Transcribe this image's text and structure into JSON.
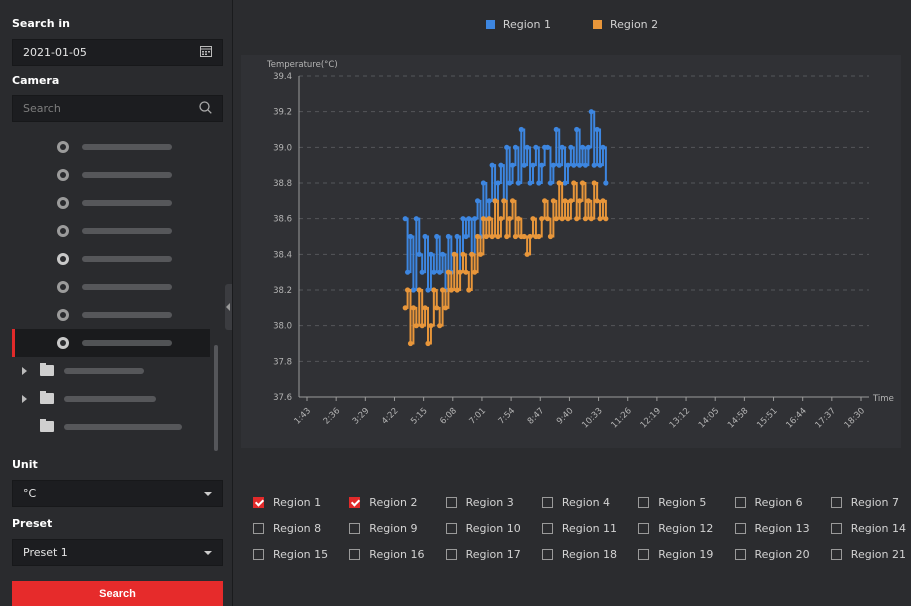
{
  "left": {
    "search_in_label": "Search in",
    "date_value": "2021-01-05",
    "camera_label": "Camera",
    "search_placeholder": "Search",
    "unit_label": "Unit",
    "unit_value": "°C",
    "preset_label": "Preset",
    "preset_value": "Preset 1",
    "search_button": "Search"
  },
  "legend": [
    {
      "name": "Region 1",
      "color": "#3d86e0"
    },
    {
      "name": "Region 2",
      "color": "#e8963a"
    }
  ],
  "chart_data": {
    "type": "line",
    "ylabel": "Temperature(°C)",
    "xlabel": "Time",
    "ylim": [
      37.6,
      39.4
    ],
    "yticks": [
      "37.6",
      "37.8",
      "38.0",
      "38.2",
      "38.4",
      "38.6",
      "38.8",
      "39.0",
      "39.2",
      "39.4"
    ],
    "x_ticks": [
      "1:43",
      "2:36",
      "3:29",
      "4:22",
      "5:15",
      "6:08",
      "7:01",
      "7:54",
      "8:47",
      "9:40",
      "10:33",
      "11:26",
      "12:19",
      "13:12",
      "14:05",
      "14:58",
      "15:51",
      "16:44",
      "17:37",
      "18:30"
    ],
    "grid": "dashed horizontal",
    "series": [
      {
        "name": "Region 1",
        "color": "#3d86e0",
        "x": [
          4.37,
          4.45,
          4.55,
          4.65,
          4.75,
          4.85,
          4.95,
          5.05,
          5.15,
          5.25,
          5.35,
          5.45,
          5.55,
          5.65,
          5.75,
          5.85,
          5.95,
          6.05,
          6.15,
          6.25,
          6.35,
          6.45,
          6.55,
          6.65,
          6.75,
          6.85,
          6.95,
          7.05,
          7.15,
          7.25,
          7.35,
          7.45,
          7.55,
          7.65,
          7.75,
          7.85,
          7.95,
          8.05,
          8.15,
          8.25,
          8.35,
          8.45,
          8.55,
          8.65,
          8.75,
          8.85,
          8.95,
          9.05,
          9.15,
          9.25,
          9.35,
          9.45,
          9.55,
          9.65,
          9.75,
          9.85,
          9.95,
          10.05,
          10.15,
          10.25,
          10.35,
          10.45,
          10.55,
          10.65,
          10.75,
          10.85,
          10.95,
          11.05,
          11.15,
          11.25
        ],
        "y": [
          38.6,
          38.3,
          38.5,
          38.2,
          38.6,
          38.4,
          38.3,
          38.5,
          38.2,
          38.4,
          38.3,
          38.5,
          38.3,
          38.4,
          38.2,
          38.5,
          38.3,
          38.4,
          38.5,
          38.3,
          38.6,
          38.5,
          38.6,
          38.4,
          38.6,
          38.7,
          38.5,
          38.8,
          38.6,
          38.7,
          38.9,
          38.7,
          38.8,
          38.9,
          38.7,
          39.0,
          38.8,
          38.9,
          39.0,
          38.8,
          39.1,
          38.9,
          39.0,
          38.8,
          38.9,
          39.0,
          38.8,
          38.9,
          39.0,
          39.0,
          38.8,
          38.9,
          39.1,
          38.9,
          39.0,
          38.8,
          38.9,
          39.0,
          38.9,
          39.1,
          38.9,
          39.0,
          38.9,
          39.0,
          39.2,
          38.9,
          39.1,
          38.9,
          39.0,
          38.8
        ]
      },
      {
        "name": "Region 2",
        "color": "#e8963a",
        "x": [
          4.37,
          4.45,
          4.55,
          4.65,
          4.75,
          4.85,
          4.95,
          5.05,
          5.15,
          5.25,
          5.35,
          5.45,
          5.55,
          5.65,
          5.75,
          5.85,
          5.95,
          6.05,
          6.15,
          6.25,
          6.35,
          6.45,
          6.55,
          6.65,
          6.75,
          6.85,
          6.95,
          7.05,
          7.15,
          7.25,
          7.35,
          7.45,
          7.55,
          7.65,
          7.75,
          7.85,
          7.95,
          8.05,
          8.15,
          8.25,
          8.35,
          8.45,
          8.55,
          8.65,
          8.75,
          8.85,
          8.95,
          9.05,
          9.15,
          9.25,
          9.35,
          9.45,
          9.55,
          9.65,
          9.75,
          9.85,
          9.95,
          10.05,
          10.15,
          10.25,
          10.35,
          10.45,
          10.55,
          10.65,
          10.75,
          10.85,
          10.95,
          11.05,
          11.15,
          11.25
        ],
        "y": [
          38.1,
          38.2,
          37.9,
          38.1,
          38.0,
          38.2,
          38.0,
          38.1,
          37.9,
          38.0,
          38.2,
          38.1,
          38.0,
          38.2,
          38.1,
          38.3,
          38.2,
          38.4,
          38.2,
          38.3,
          38.4,
          38.3,
          38.2,
          38.4,
          38.3,
          38.5,
          38.4,
          38.6,
          38.5,
          38.6,
          38.5,
          38.7,
          38.5,
          38.6,
          38.7,
          38.5,
          38.6,
          38.7,
          38.5,
          38.6,
          38.5,
          38.5,
          38.4,
          38.5,
          38.6,
          38.5,
          38.5,
          38.6,
          38.7,
          38.6,
          38.5,
          38.7,
          38.6,
          38.8,
          38.6,
          38.7,
          38.6,
          38.7,
          38.8,
          38.6,
          38.7,
          38.8,
          38.6,
          38.7,
          38.6,
          38.8,
          38.7,
          38.6,
          38.7,
          38.6
        ]
      }
    ]
  },
  "regions": [
    {
      "label": "Region 1",
      "checked": true
    },
    {
      "label": "Region 2",
      "checked": true
    },
    {
      "label": "Region 3",
      "checked": false
    },
    {
      "label": "Region 4",
      "checked": false
    },
    {
      "label": "Region 5",
      "checked": false
    },
    {
      "label": "Region 6",
      "checked": false
    },
    {
      "label": "Region 7",
      "checked": false
    },
    {
      "label": "Region 8",
      "checked": false
    },
    {
      "label": "Region 9",
      "checked": false
    },
    {
      "label": "Region 10",
      "checked": false
    },
    {
      "label": "Region 11",
      "checked": false
    },
    {
      "label": "Region 12",
      "checked": false
    },
    {
      "label": "Region 13",
      "checked": false
    },
    {
      "label": "Region 14",
      "checked": false
    },
    {
      "label": "Region 15",
      "checked": false
    },
    {
      "label": "Region 16",
      "checked": false
    },
    {
      "label": "Region 17",
      "checked": false
    },
    {
      "label": "Region 18",
      "checked": false
    },
    {
      "label": "Region 19",
      "checked": false
    },
    {
      "label": "Region 20",
      "checked": false
    },
    {
      "label": "Region 21",
      "checked": false
    }
  ]
}
